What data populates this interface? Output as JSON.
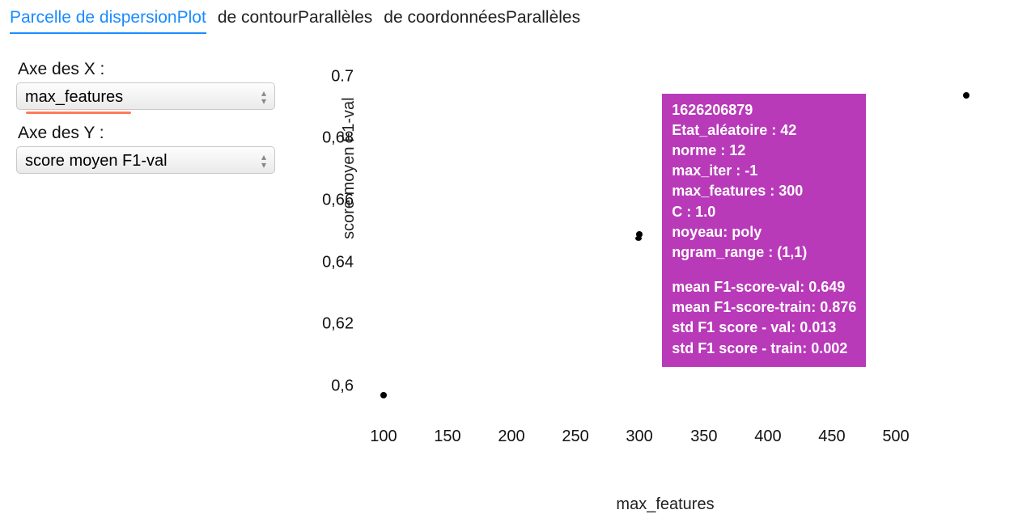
{
  "tabs": [
    {
      "label": "Parcelle de dispersionPlot",
      "active": true
    },
    {
      "label": "de contourParallèles",
      "active": false
    },
    {
      "label": "de coordonnéesParallèles",
      "active": false
    }
  ],
  "controls": {
    "x_label": "Axe des X :",
    "x_value": "max_features",
    "y_label": "Axe des Y :",
    "y_value": "score moyen F1-val"
  },
  "chart_data": {
    "type": "scatter",
    "xlabel": "max_features",
    "ylabel": "score moyen F1-val",
    "xlim": [
      80,
      560
    ],
    "ylim": [
      0.59,
      0.705
    ],
    "xticks": [
      100,
      150,
      200,
      250,
      300,
      350,
      400,
      450,
      500
    ],
    "yticks": [
      0.6,
      0.62,
      0.64,
      0.66,
      0.68,
      0.7
    ],
    "ytick_labels": [
      "0,6",
      "0,62",
      "0,64",
      "0,66",
      "0,68",
      "0.7"
    ],
    "points": [
      {
        "x": 100,
        "y": 0.597
      },
      {
        "x": 300,
        "y": 0.649
      },
      {
        "x": 300,
        "y": 0.647
      },
      {
        "x": 555,
        "y": 0.694
      }
    ]
  },
  "tooltip": {
    "id": "1626206879",
    "rows1": [
      "Etat_aléatoire : 42",
      "norme : 12",
      "max_iter : -1",
      "max_features : 300",
      "C : 1.0",
      "noyeau: poly",
      "ngram_range : (1,1)"
    ],
    "rows2": [
      "mean F1-score-val: 0.649",
      "mean F1-score-train: 0.876",
      "std F1 score - val: 0.013",
      "std F1 score - train: 0.002"
    ]
  }
}
